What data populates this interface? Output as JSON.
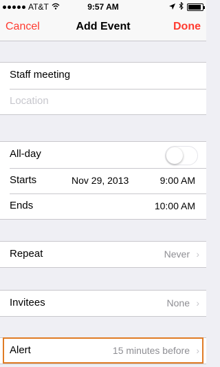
{
  "status_bar": {
    "carrier": "AT&T",
    "time": "9:57 AM"
  },
  "nav": {
    "cancel": "Cancel",
    "title": "Add Event",
    "done": "Done"
  },
  "event": {
    "title": "Staff meeting",
    "location_placeholder": "Location"
  },
  "all_day": {
    "label": "All-day",
    "enabled": false
  },
  "starts": {
    "label": "Starts",
    "date": "Nov 29, 2013",
    "time": "9:00 AM"
  },
  "ends": {
    "label": "Ends",
    "time": "10:00 AM"
  },
  "repeat": {
    "label": "Repeat",
    "value": "Never"
  },
  "invitees": {
    "label": "Invitees",
    "value": "None"
  },
  "alert": {
    "label": "Alert",
    "value": "15 minutes before"
  },
  "colors": {
    "accent": "#ff3b30",
    "highlight": "#e07b24"
  }
}
